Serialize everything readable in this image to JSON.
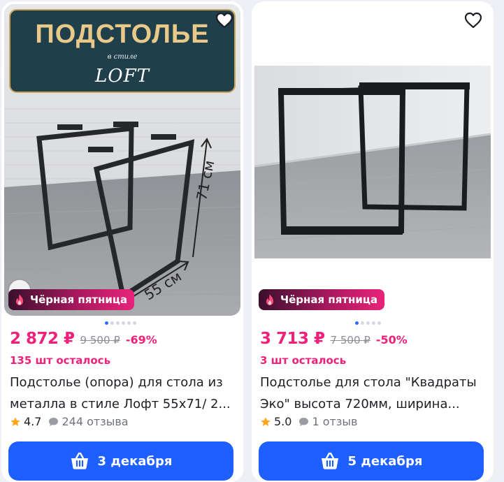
{
  "products": [
    {
      "image": {
        "banner_title": "ПОДСТОЛЬЕ",
        "banner_subtitle": "в стиле",
        "banner_style": "LOFT",
        "dimension_height": "71 см",
        "dimension_depth": "55 см"
      },
      "badge": "Чёрная пятница",
      "price": "2 872 ₽",
      "old_price": "9 500 ₽",
      "discount": "-69%",
      "stock": "135 шт осталось",
      "title": "Подстолье (опора) для стола из металла в стиле Лофт 55х71/ 2...",
      "rating": "4.7",
      "reviews": "244 отзыва",
      "delivery": "3 декабря"
    },
    {
      "badge": "Чёрная пятница",
      "price": "3 713 ₽",
      "old_price": "7 500 ₽",
      "discount": "-50%",
      "stock": "3 шт осталось",
      "title": "Подстолье для стола \"Квадраты Эко\" высота 720мм, ширина...",
      "rating": "5.0",
      "reviews": "1 отзыв",
      "delivery": "5 декабря"
    }
  ],
  "colors": {
    "accent_pink": "#f0217a",
    "button_blue": "#1e5fff",
    "star": "#ffa41b"
  },
  "icons": {
    "favorite": "heart-outline-icon",
    "badge": "flame-icon",
    "rating": "star-icon",
    "reviews": "chat-bubble-icon",
    "delivery": "basket-icon"
  }
}
